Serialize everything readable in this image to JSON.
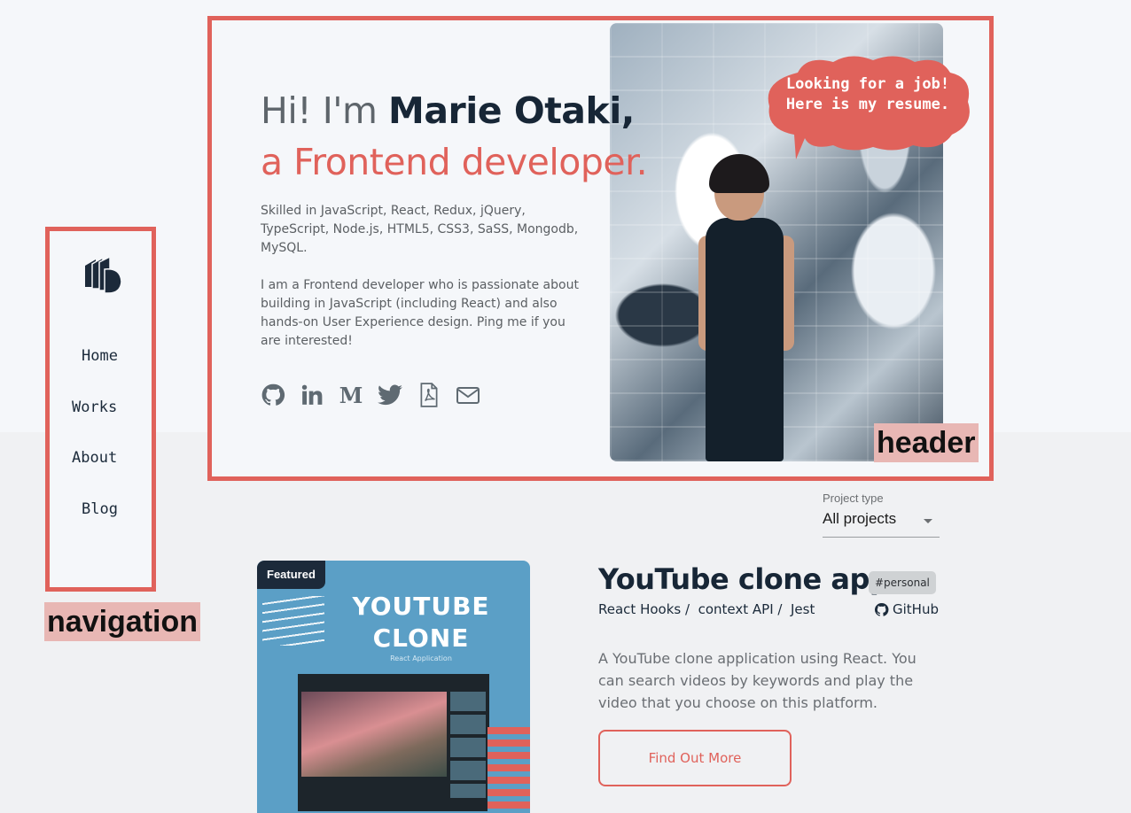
{
  "header": {
    "greeting": "Hi! I'm ",
    "name": "Marie Otaki,",
    "role": "a Frontend developer.",
    "skills": "Skilled in JavaScript, React, Redux, jQuery, TypeScript, Node.js, HTML5, CSS3, SaSS, Mongodb, MySQL.",
    "bio": "I am a Frontend developer who is passionate about building in JavaScript (including React) and also hands-on User Experience design. Ping me if you are interested!",
    "bubble_line1": "Looking for a job!",
    "bubble_line2": "Here is my resume.",
    "social_icons": [
      "github-icon",
      "linkedin-icon",
      "medium-icon",
      "twitter-icon",
      "pdf-icon",
      "mail-icon"
    ]
  },
  "navigation": {
    "items": [
      {
        "label": "Home"
      },
      {
        "label": "Works"
      },
      {
        "label": "About"
      },
      {
        "label": "Blog"
      }
    ]
  },
  "annotations": {
    "header_tag": "header",
    "navigation_tag": "navigation",
    "color": "#e0625b"
  },
  "filter": {
    "label": "Project type",
    "selected": "All projects"
  },
  "project": {
    "featured": "Featured",
    "thumb_title_line1": "YOUTUBE",
    "thumb_title_line2": "CLONE",
    "thumb_subtitle": "React Application",
    "title": "YouTube clone app",
    "badge": "#personal",
    "tech": [
      "React Hooks /",
      "context API /",
      "Jest"
    ],
    "github_label": "GitHub",
    "description": "A YouTube clone application using React. You can search videos by keywords and play the video that you choose on this platform.",
    "cta": "Find Out More"
  },
  "colors": {
    "accent": "#e0625b",
    "navy": "#172636",
    "background": "#f5f7fa"
  }
}
